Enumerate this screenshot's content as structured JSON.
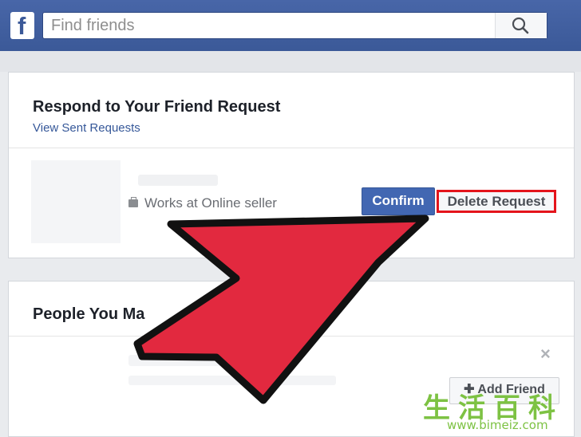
{
  "header": {
    "logo_letter": "f",
    "search_placeholder": "Find friends"
  },
  "friend_requests": {
    "title": "Respond to Your Friend Request",
    "view_sent_link": "View Sent Requests",
    "request": {
      "work": "Works at Online seller",
      "confirm_label": "Confirm",
      "delete_label": "Delete Request"
    }
  },
  "suggestions": {
    "title": "People You Ma",
    "add_friend_label": "Add Friend",
    "close_symbol": "×"
  },
  "annotation": {
    "arrow_color": "#e2293f",
    "highlight_color": "#e4141b"
  },
  "watermark": {
    "chars": [
      "生",
      "活",
      "百",
      "科"
    ],
    "url": "www.bimeiz.com"
  }
}
